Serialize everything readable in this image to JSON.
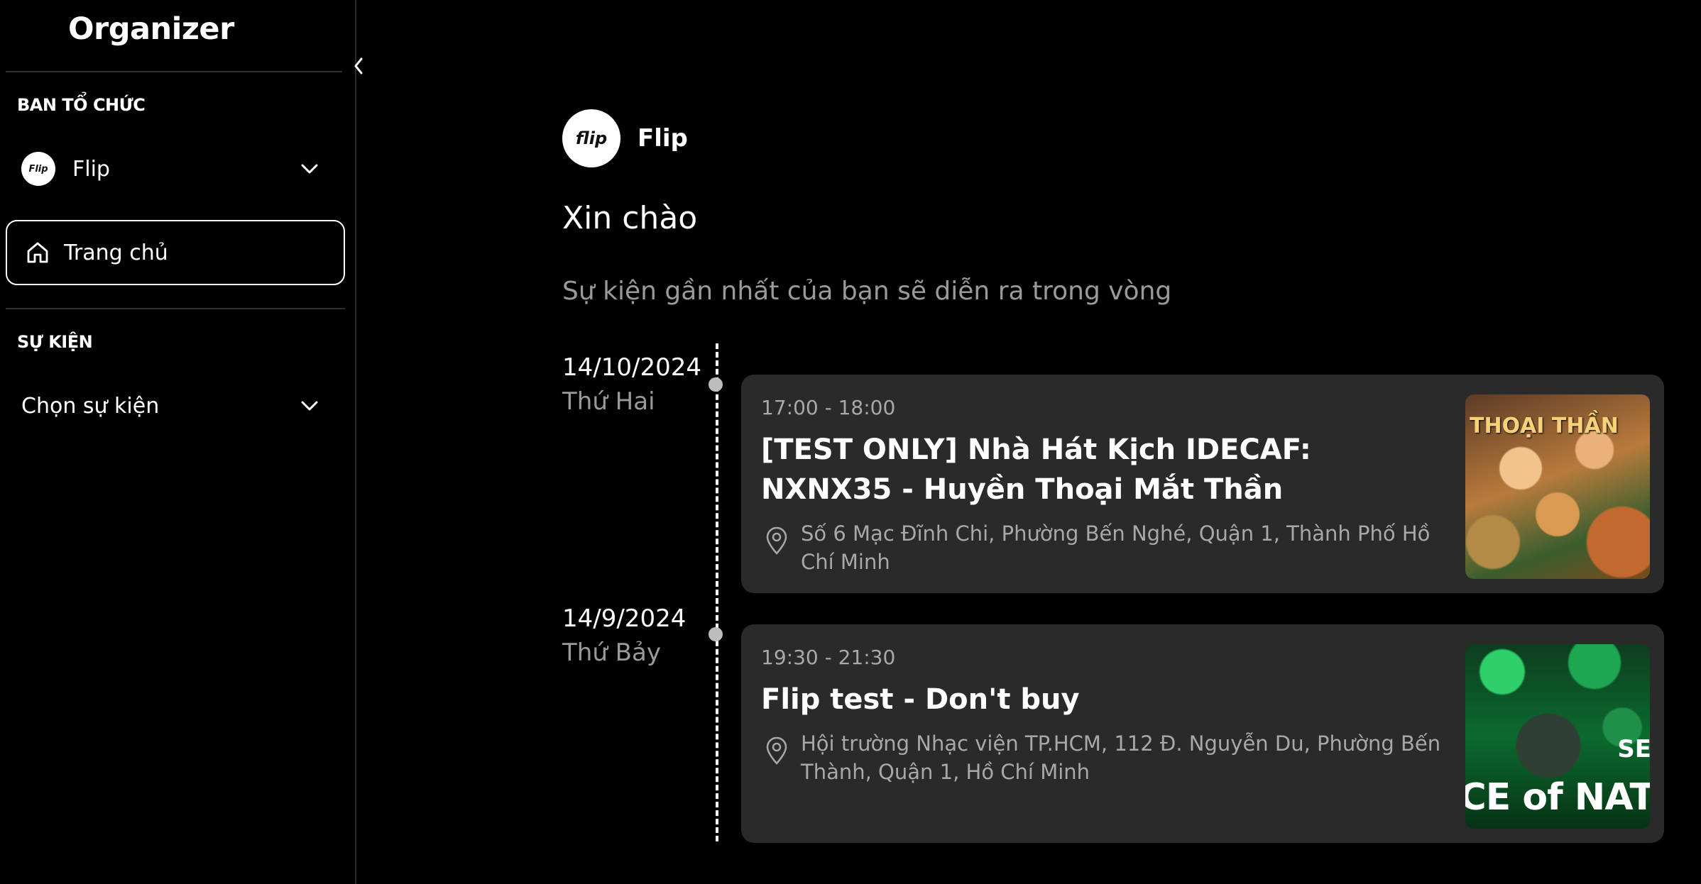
{
  "sidebar": {
    "brand": "Organizer",
    "organizer_section": "BAN TỔ CHỨC",
    "org": {
      "logo_text": "Flip",
      "name": "Flip"
    },
    "nav_home": "Trang chủ",
    "events_section": "SỰ KIỆN",
    "event_select": "Chọn sự kiện"
  },
  "main": {
    "org_logo_text": "flip",
    "org_name": "Flip",
    "greeting": "Xin chào",
    "subtitle": "Sự kiện gần nhất của bạn sẽ diễn ra trong vòng",
    "events": [
      {
        "date": "14/10/2024",
        "weekday": "Thứ Hai",
        "time": "17:00 - 18:00",
        "title": "[TEST ONLY] Nhà Hát Kịch IDECAF: NXNX35 - Huyền Thoại Mắt Thần",
        "address": "Số 6 Mạc Đĩnh Chi, Phường Bến Nghé, Quận 1, Thành Phố Hồ Chí Minh",
        "thumb_text": "THOẠI THẦN"
      },
      {
        "date": "14/9/2024",
        "weekday": "Thứ Bảy",
        "time": "19:30 - 21:30",
        "title": "Flip test - Don't buy",
        "address": "Hội trường Nhạc viện TP.HCM, 112 Đ. Nguyễn Du, Phường Bến Thành, Quận 1, Hồ Chí Minh",
        "thumb_text": "CE of NAT",
        "thumb_text_2": "SE"
      }
    ]
  },
  "icons": {
    "collapse": "chevron-left-icon",
    "dropdown": "chevron-down-icon",
    "home": "home-icon",
    "location": "map-pin-icon"
  }
}
